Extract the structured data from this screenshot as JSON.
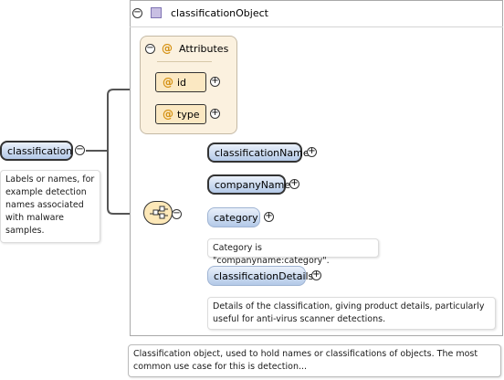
{
  "root_element": {
    "label": "classification",
    "annotation": "Labels or names, for example detection names associated with malware samples."
  },
  "type": {
    "label": "classificationObject",
    "annotation": "Classification object, used to hold names or classifications of objects. The most common use case for this is detection..."
  },
  "attributes": {
    "title": "Attributes",
    "items": [
      "id",
      "type"
    ]
  },
  "children": [
    {
      "label": "classificationName"
    },
    {
      "label": "companyName"
    },
    {
      "label": "category",
      "annotation": "Category is \"companyname:category\"."
    },
    {
      "label": "classificationDetails",
      "annotation": "Details of the classification, giving product details, particularly useful for anti-virus scanner detections."
    }
  ],
  "symbols": {
    "collapse": "−",
    "expand": "+",
    "attribute": "@"
  }
}
